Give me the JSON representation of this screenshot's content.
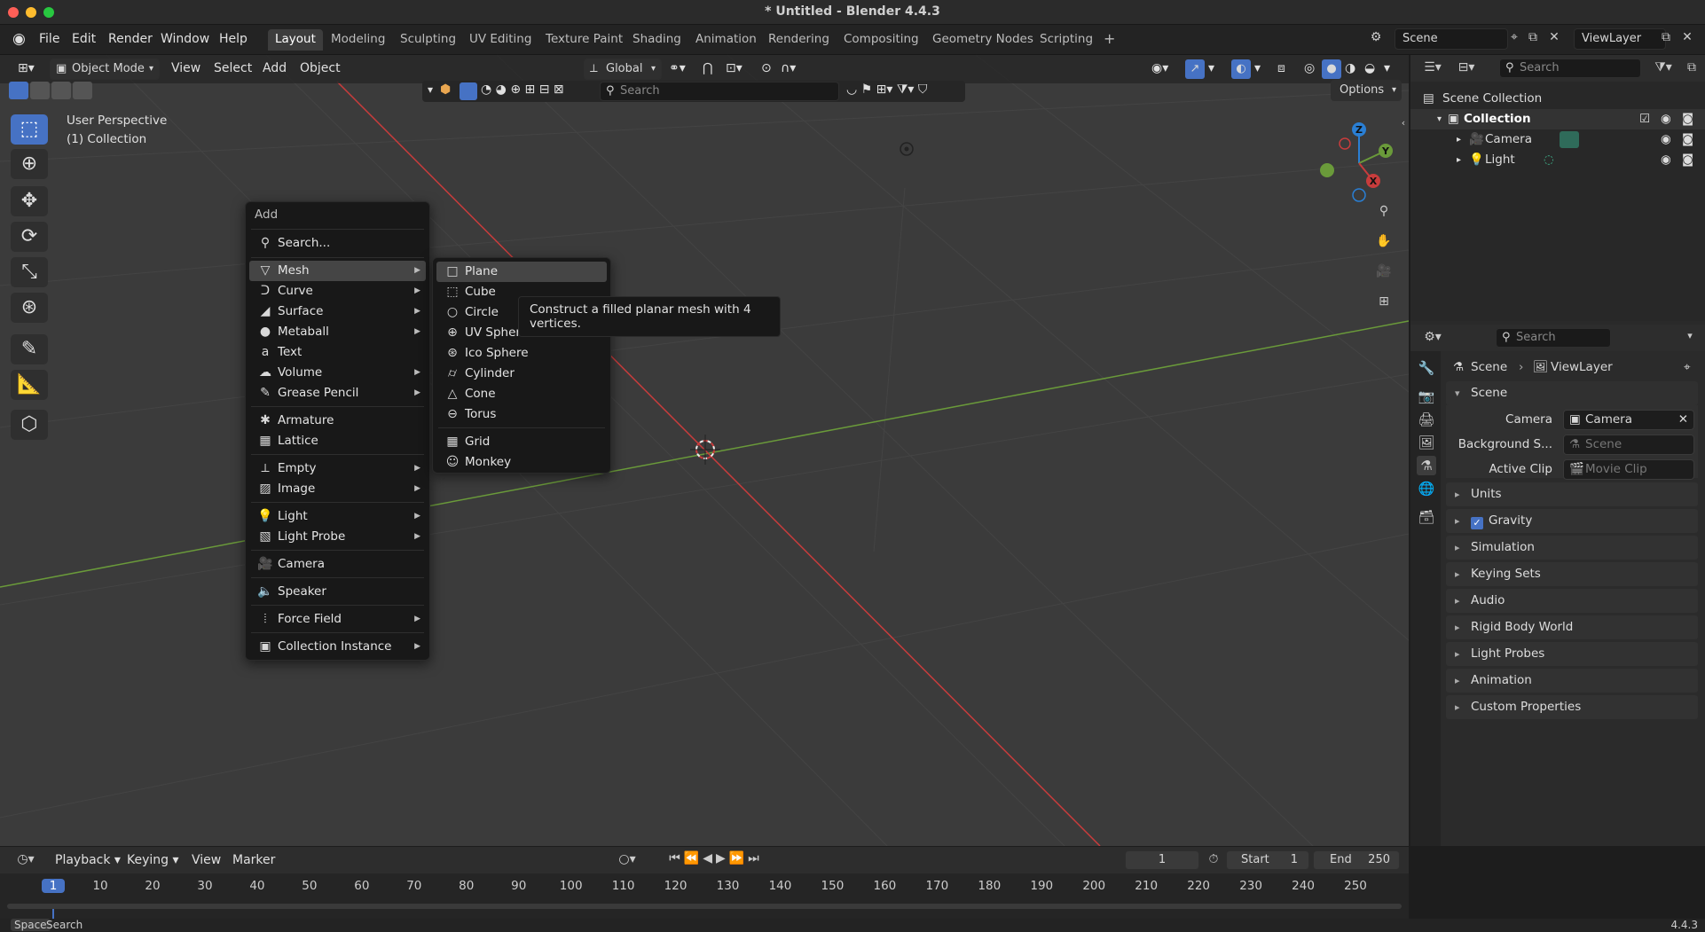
{
  "window_title": "* Untitled - Blender 4.4.3",
  "top_menu": [
    "File",
    "Edit",
    "Render",
    "Window",
    "Help"
  ],
  "workspaces": [
    "Layout",
    "Modeling",
    "Sculpting",
    "UV Editing",
    "Texture Paint",
    "Shading",
    "Animation",
    "Rendering",
    "Compositing",
    "Geometry Nodes",
    "Scripting"
  ],
  "active_workspace": "Layout",
  "scene_name": "Scene",
  "view_layer": "ViewLayer",
  "viewport": {
    "mode": "Object Mode",
    "menus": [
      "View",
      "Select",
      "Add",
      "Object"
    ],
    "transform_orientation": "Global",
    "search_placeholder": "Search",
    "options_label": "Options",
    "overlay_line1": "User Perspective",
    "overlay_line2": "(1) Collection",
    "gizmo": {
      "z": "Z",
      "y": "Y",
      "x": "X"
    }
  },
  "add_menu": {
    "title": "Add",
    "search": "Search...",
    "items": [
      {
        "label": "Mesh",
        "icon": "mesh-icon",
        "submenu": true,
        "selected": true
      },
      {
        "label": "Curve",
        "icon": "curve-icon",
        "submenu": true
      },
      {
        "label": "Surface",
        "icon": "surface-icon",
        "submenu": true
      },
      {
        "label": "Metaball",
        "icon": "metaball-icon",
        "submenu": true
      },
      {
        "label": "Text",
        "icon": "text-icon",
        "submenu": false
      },
      {
        "label": "Volume",
        "icon": "volume-icon",
        "submenu": true
      },
      {
        "label": "Grease Pencil",
        "icon": "grease-pencil-icon",
        "submenu": true
      },
      {
        "label": "Armature",
        "icon": "armature-icon",
        "submenu": false
      },
      {
        "label": "Lattice",
        "icon": "lattice-icon",
        "submenu": false
      },
      {
        "label": "Empty",
        "icon": "empty-icon",
        "submenu": true
      },
      {
        "label": "Image",
        "icon": "image-icon",
        "submenu": true
      },
      {
        "label": "Light",
        "icon": "light-icon",
        "submenu": true
      },
      {
        "label": "Light Probe",
        "icon": "light-probe-icon",
        "submenu": true
      },
      {
        "label": "Camera",
        "icon": "camera-icon",
        "submenu": false
      },
      {
        "label": "Speaker",
        "icon": "speaker-icon",
        "submenu": false
      },
      {
        "label": "Force Field",
        "icon": "force-field-icon",
        "submenu": true
      },
      {
        "label": "Collection Instance",
        "icon": "collection-instance-icon",
        "submenu": true
      }
    ]
  },
  "mesh_menu": {
    "items": [
      "Plane",
      "Cube",
      "Circle",
      "UV Sphere",
      "Ico Sphere",
      "Cylinder",
      "Cone",
      "Torus",
      "Grid",
      "Monkey"
    ],
    "selected": "Plane"
  },
  "tooltip": "Construct a filled planar mesh with 4 vertices.",
  "outliner": {
    "search_placeholder": "Search",
    "scene_collection": "Scene Collection",
    "collection": "Collection",
    "objects": [
      "Camera",
      "Light"
    ]
  },
  "properties": {
    "search_placeholder": "Search",
    "breadcrumb_scene": "Scene",
    "breadcrumb_view_layer": "ViewLayer",
    "scene_panel": "Scene",
    "camera_label": "Camera",
    "camera_value": "Camera",
    "background_label": "Background S...",
    "background_value": "Scene",
    "active_clip_label": "Active Clip",
    "active_clip_value": "Movie Clip",
    "panels": [
      "Units",
      "Gravity",
      "Simulation",
      "Keying Sets",
      "Audio",
      "Rigid Body World",
      "Light Probes",
      "Animation",
      "Custom Properties"
    ]
  },
  "timeline": {
    "menus": [
      "Playback",
      "Keying",
      "View",
      "Marker"
    ],
    "current_frame": "1",
    "start_label": "Start",
    "start_value": "1",
    "end_label": "End",
    "end_value": "250",
    "ruler": [
      "1",
      "10",
      "20",
      "30",
      "40",
      "50",
      "60",
      "70",
      "80",
      "90",
      "100",
      "110",
      "120",
      "130",
      "140",
      "150",
      "160",
      "170",
      "180",
      "190",
      "200",
      "210",
      "220",
      "230",
      "240",
      "250"
    ]
  },
  "status_bar": {
    "key": "Space",
    "action": "Search",
    "version": "4.4.3"
  },
  "colors": {
    "accent": "#4672c4",
    "x_axis": "#c83c3c",
    "y_axis": "#6a9a3a"
  }
}
